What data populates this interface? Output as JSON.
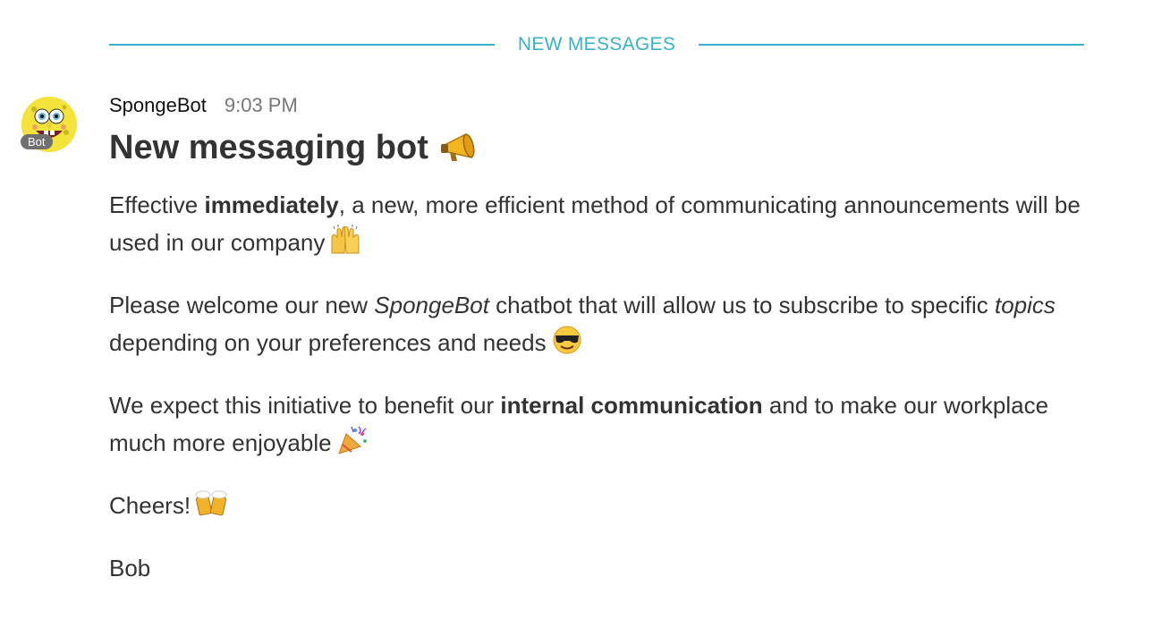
{
  "divider": {
    "label": "NEW MESSAGES"
  },
  "avatar": {
    "badge": "Bot",
    "icon": "spongebob-avatar-icon"
  },
  "message": {
    "sender": "SpongeBot",
    "timestamp": "9:03 PM",
    "heading": {
      "text": "New messaging bot",
      "emoji": "megaphone-icon"
    },
    "paragraph1": {
      "t1": "Effective ",
      "b1": "immediately",
      "t2": ", a new, more efficient method of communicating announcements will be used in our company",
      "emoji": "raised-hands-icon"
    },
    "paragraph2": {
      "t1": "Please welcome our new ",
      "i1": "SpongeBot",
      "t2": " chatbot that will allow us to subscribe to specific ",
      "i2": "topics",
      "t3": " depending on your preferences and needs",
      "emoji": "sunglasses-face-icon"
    },
    "paragraph3": {
      "t1": "We expect this initiative to benefit our ",
      "b1": "internal communication",
      "t2": " and to make our workplace much more enjoyable",
      "emoji": "party-popper-icon"
    },
    "paragraph4": {
      "text": "Cheers!",
      "emoji": "beer-mugs-icon"
    },
    "paragraph5": {
      "text": "Bob"
    }
  },
  "colors": {
    "accent": "#36b3c9",
    "text": "#333333",
    "muted": "#777777",
    "badge": "#707070"
  }
}
